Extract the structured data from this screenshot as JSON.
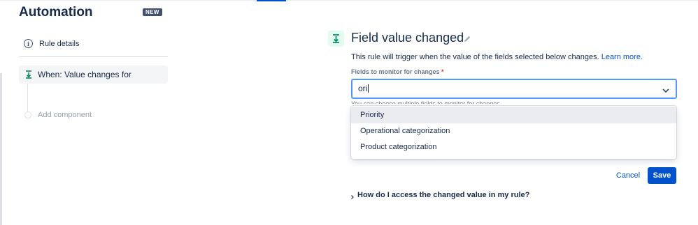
{
  "header": {
    "app_title": "Automation",
    "badge": "NEW"
  },
  "sidebar": {
    "rule_details": "Rule details",
    "trigger": "When: Value changes for",
    "add_component": "Add component"
  },
  "panel": {
    "title": "Field value changed",
    "description": "This rule will trigger when the value of the fields selected below changes.",
    "learn_more": "Learn more.",
    "field_label": "Fields to monitor for changes",
    "required_marker": "*",
    "input_value": "ori",
    "helper_text": "You can choose multiple fields to monitor for changes.",
    "options": [
      {
        "label": "Priority",
        "highlighted": true
      },
      {
        "label": "Operational categorization",
        "highlighted": false
      },
      {
        "label": "Product categorization",
        "highlighted": false
      }
    ],
    "cancel": "Cancel",
    "save": "Save",
    "faq": "How do I access the changed value in my rule?"
  },
  "icons": {
    "info": "info-icon",
    "trigger": "trigger-arrow-icon",
    "edit": "pencil-icon",
    "dropdown": "chevron-down-icon",
    "faq": "chevron-right-icon"
  },
  "colors": {
    "primary": "#0052cc",
    "focus_border": "#4c9aff",
    "trigger_green": "#00875a",
    "trigger_bg": "#e3fcef",
    "required": "#de350b",
    "badge_bg": "#42526e"
  }
}
